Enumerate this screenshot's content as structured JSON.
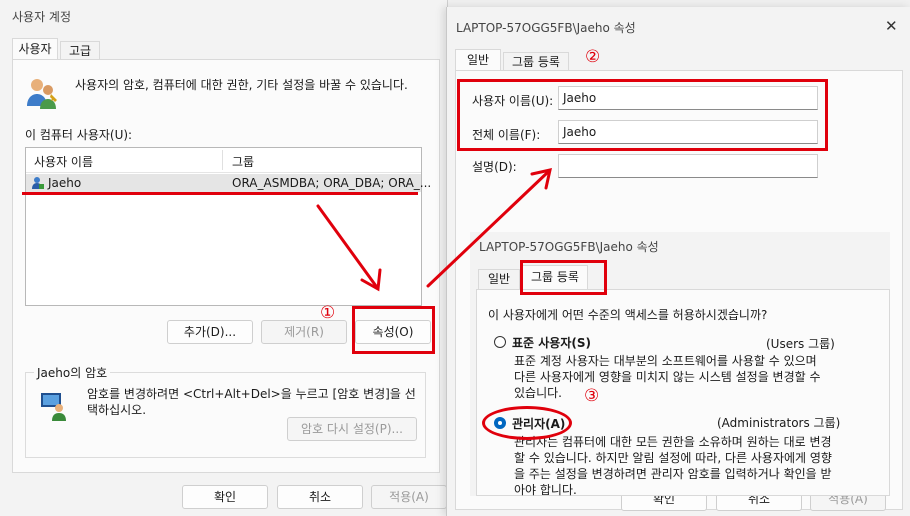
{
  "win1": {
    "title": "사용자 계정",
    "tabs": [
      "사용자",
      "고급"
    ],
    "intro": "사용자의 암호, 컴퓨터에 대한 권한, 기타 설정을 바꿀 수 있습니다.",
    "list_label": "이 컴퓨터 사용자(U):",
    "columns": [
      "사용자 이름",
      "그룹"
    ],
    "row": {
      "user": "Jaeho",
      "group": "ORA_ASMDBA; ORA_DBA; ORA_..."
    },
    "buttons": {
      "add": "추가(D)...",
      "remove": "제거(R)",
      "props": "속성(O)"
    },
    "pwd_section": "Jaeho의 암호",
    "pwd_text_1": "암호를 변경하려면 <Ctrl+Alt+Del>을 누르고 [암호 변경]을 선",
    "pwd_text_2": "택하십시오.",
    "reset_btn": "암호 다시 설정(P)...",
    "ok": "확인",
    "cancel": "취소",
    "apply": "적용(A)"
  },
  "win2": {
    "title": "LAPTOP-57OGG5FB\\Jaeho 속성",
    "close": "✕",
    "tabs": [
      "일반",
      "그룹 등록"
    ],
    "username_label": "사용자 이름(U):",
    "username": "Jaeho",
    "fullname_label": "전체 이름(F):",
    "fullname": "Jaeho",
    "desc_label": "설명(D):",
    "desc": "",
    "ok": "확인",
    "cancel": "취소",
    "apply": "적용(A)"
  },
  "win3": {
    "title": "LAPTOP-57OGG5FB\\Jaeho 속성",
    "tabs": [
      "일반",
      "그룹 등록"
    ],
    "question": "이 사용자에게 어떤 수준의 액세스를 허용하시겠습니까?",
    "std_label": "표준 사용자(S)",
    "std_group": "(Users 그룹)",
    "std_desc_1": "표준 계정 사용자는 대부분의 소프트웨어를 사용할 수 있으며",
    "std_desc_2": "다른 사용자에게 영향을 미치지 않는 시스템 설정을 변경할 수",
    "std_desc_3": "있습니다.",
    "admin_label": "관리자(A)",
    "admin_group": "(Administrators 그룹)",
    "admin_desc_1": "관리자는 컴퓨터에 대한 모든 권한을 소유하며 원하는 대로 변경",
    "admin_desc_2": "할 수 있습니다. 하지만 알림 설정에 따라, 다른 사용자에게 영향",
    "admin_desc_3": "을 주는 설정을 변경하려면 관리자 암호를 입력하거나 확인을 받",
    "admin_desc_4": "아야 합니다.",
    "admin_selected": true
  },
  "annotations": {
    "n1": "①",
    "n2": "②",
    "n3": "③"
  },
  "colors": {
    "annotation_red": "#e0000c",
    "accent_blue": "#0067c0",
    "selected_row": "#e5e5e5"
  }
}
